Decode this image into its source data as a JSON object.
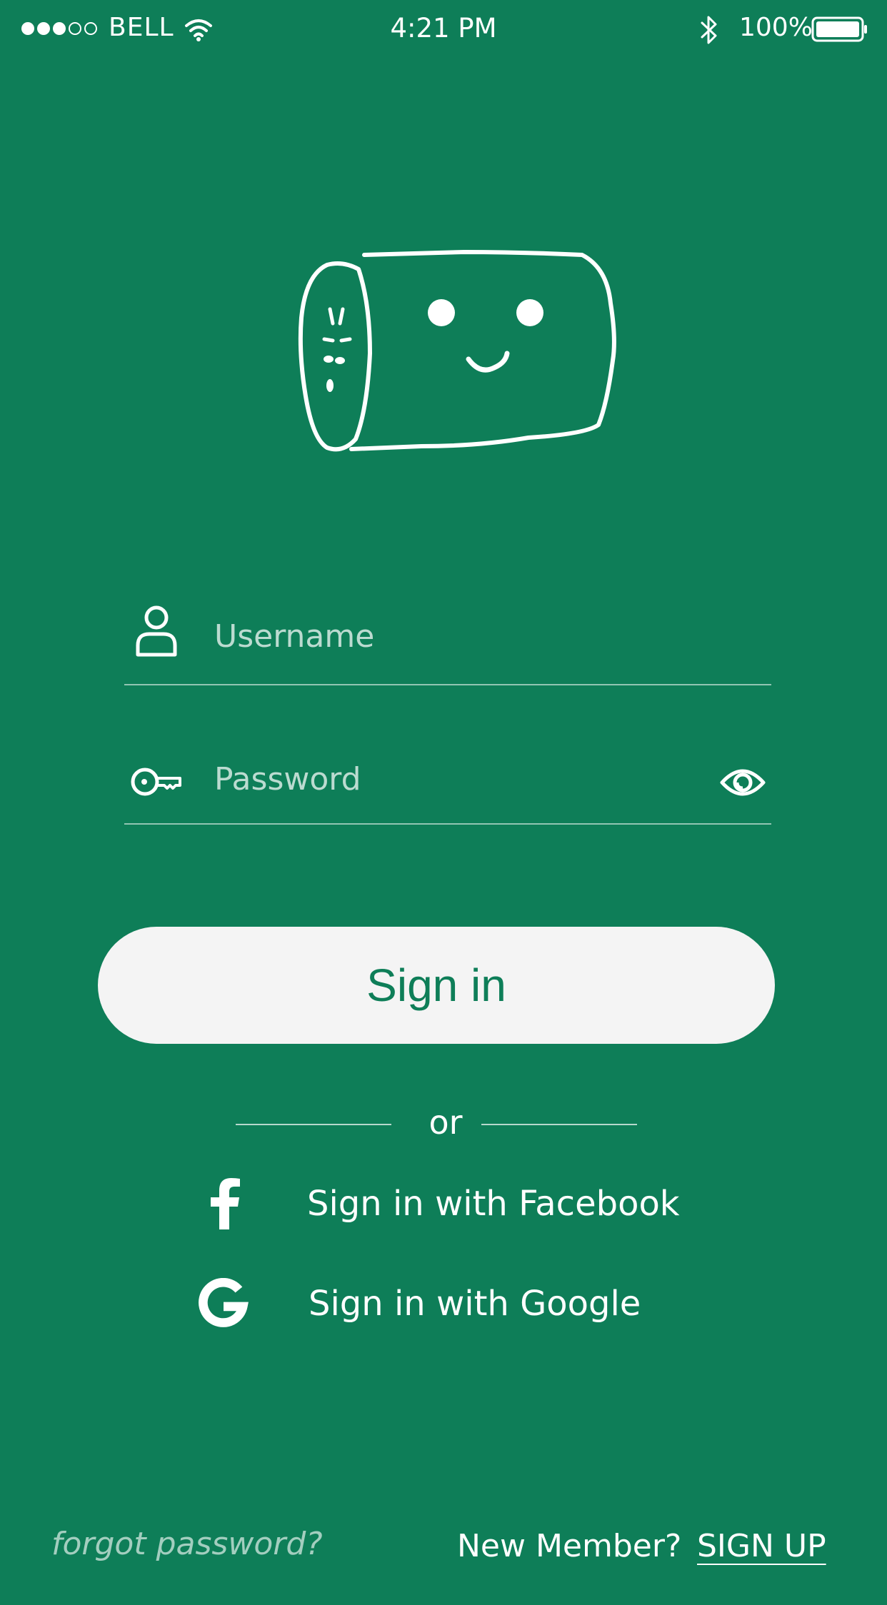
{
  "status_bar": {
    "carrier": "BELL",
    "time": "4:21 PM",
    "battery": "100%",
    "signal_bars_filled": 3,
    "signal_bars_total": 5
  },
  "login": {
    "username_placeholder": "Username",
    "password_placeholder": "Password",
    "sign_in_label": "Sign in",
    "or_label": "or",
    "facebook_label": "Sign in with Facebook",
    "google_label": "Sign in with Google"
  },
  "footer": {
    "forgot_label": "forgot password?",
    "new_member_label": "New Member?",
    "sign_up_label": "SIGN UP"
  },
  "icons": {
    "user": "user-icon",
    "key": "key-icon",
    "eye": "eye-icon",
    "facebook": "facebook-icon",
    "google": "google-icon",
    "wifi": "wifi-icon",
    "bluetooth": "bluetooth-icon",
    "battery": "battery-icon"
  },
  "colors": {
    "background": "#0e7e58",
    "button": "#f4f4f4",
    "button_text": "#0e7e58",
    "text": "#ffffff"
  }
}
